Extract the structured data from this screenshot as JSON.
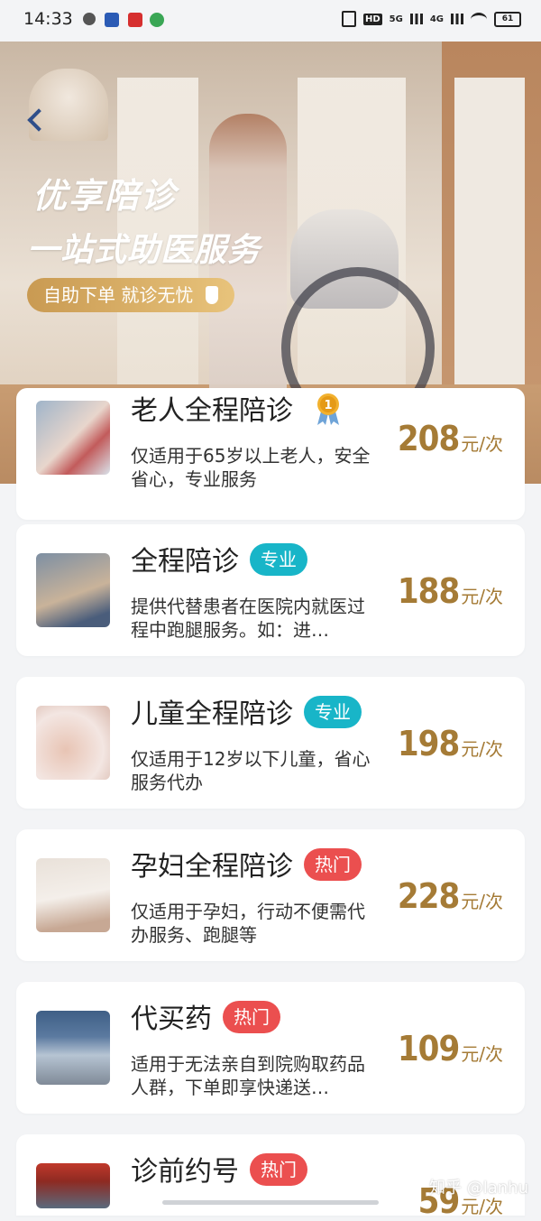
{
  "status_bar": {
    "time": "14:33",
    "right_items": [
      "HD",
      "5G",
      "4G"
    ],
    "battery": "61"
  },
  "hero": {
    "title": "优享陪诊",
    "subtitle": "一站式助医服务",
    "button_label": "自助下单 就诊无忧"
  },
  "services": [
    {
      "title": "老人全程陪诊",
      "badge": "",
      "desc": "仅适用于65岁以上老人，安全省心，专业服务",
      "price": "208",
      "unit": "元/次"
    },
    {
      "title": "全程陪诊",
      "badge": "专业",
      "desc": "提供代替患者在医院内就医过程中跑腿服务。如：进…",
      "price": "188",
      "unit": "元/次"
    },
    {
      "title": "儿童全程陪诊",
      "badge": "专业",
      "desc": "仅适用于12岁以下儿童，省心服务代办",
      "price": "198",
      "unit": "元/次"
    },
    {
      "title": "孕妇全程陪诊",
      "badge": "热门",
      "desc": "仅适用于孕妇，行动不便需代办服务、跑腿等",
      "price": "228",
      "unit": "元/次"
    },
    {
      "title": "代买药",
      "badge": "热门",
      "desc": "适用于无法亲自到院购取药品人群，下单即享快递送…",
      "price": "109",
      "unit": "元/次"
    },
    {
      "title": "诊前约号",
      "badge": "热门",
      "desc": "",
      "price": "59",
      "unit": "元/次"
    }
  ],
  "medal_number": "1",
  "watermark": "知乎 @lanhu"
}
